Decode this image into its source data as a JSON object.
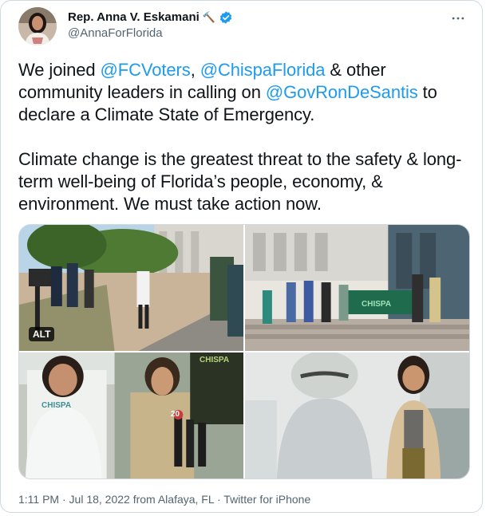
{
  "author": {
    "display_name": "Rep. Anna V. Eskamani",
    "emoji": "🔨",
    "verified": true,
    "handle": "@AnnaForFlorida",
    "avatar_icon": "profile-photo"
  },
  "tweet": {
    "p1": {
      "t1": "We joined ",
      "m1": "@FCVoters",
      "t2": ", ",
      "m2": "@ChispaFlorida",
      "t3": " & other community leaders in calling on ",
      "m3": "@GovRonDeSantis",
      "t4": " to declare a Climate State of Emergency."
    },
    "p2": "Climate change is the greatest threat to the safety & long-term well-being of Florida’s people, economy, & environment. We must take action now."
  },
  "media": {
    "alt_badge": "ALT",
    "photos": [
      {
        "icon": "press-conference-photo"
      },
      {
        "icon": "group-banner-photo"
      },
      {
        "icon": "woman-speaking-photo"
      },
      {
        "icon": "mascot-photo"
      }
    ],
    "photo_text": {
      "chispa_shirt": "CHISPA",
      "chispa_banner": "CHISPA",
      "mic_number": "20"
    }
  },
  "footer": {
    "text": "1:11 PM · Jul 18, 2022 from Alafaya, FL · Twitter for iPhone"
  },
  "colors": {
    "accent": "#1d9bf0",
    "text": "#0f1419",
    "muted": "#536471",
    "border": "#cfd9de"
  }
}
